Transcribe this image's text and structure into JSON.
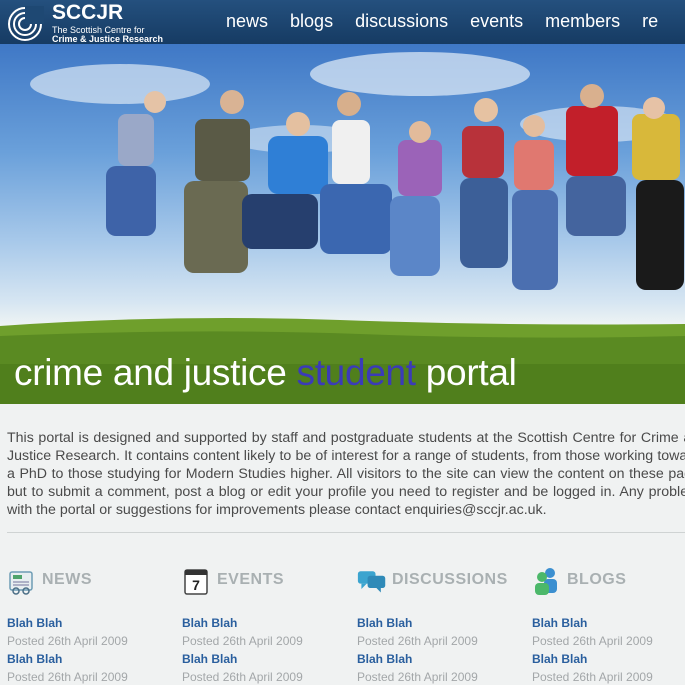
{
  "header": {
    "logo_title": "SCCJR",
    "logo_line1": "The Scottish Centre for",
    "logo_line2": "Crime & Justice Research",
    "nav": [
      "news",
      "blogs",
      "discussions",
      "events",
      "members",
      "re"
    ]
  },
  "hero": {
    "title_before": "crime and justice ",
    "title_accent": "student",
    "title_after": " portal",
    "accent_color": "#3b3bb8"
  },
  "intro": {
    "text": "This portal is designed and supported by staff and postgraduate students at the Scottish Centre for Crime and Justice Research. It contains content likely to be of interest for a range of students, from those working towards a PhD to those studying for Modern Studies higher. All visitors to the site can view the content on these pages but to submit a comment, post a blog or edit your profile you need to register and be logged in. Any problems with the portal or suggestions for improvements please contact enquiries@sccjr.ac.uk."
  },
  "columns": [
    {
      "label": "NEWS",
      "icon": "newspaper-icon",
      "items": [
        {
          "title": "Blah Blah",
          "date": "Posted 26th April 2009"
        },
        {
          "title": "Blah Blah",
          "date": "Posted 26th April 2009"
        }
      ]
    },
    {
      "label": "EVENTS",
      "icon": "calendar-icon",
      "items": [
        {
          "title": "Blah Blah",
          "date": "Posted 26th April 2009"
        },
        {
          "title": "Blah Blah",
          "date": "Posted 26th April 2009"
        }
      ]
    },
    {
      "label": "DISCUSSIONS",
      "icon": "speech-bubbles-icon",
      "items": [
        {
          "title": "Blah Blah",
          "date": "Posted 26th April 2009"
        },
        {
          "title": "Blah Blah",
          "date": "Posted 26th April 2009"
        }
      ]
    },
    {
      "label": "BLOGS",
      "icon": "people-icon",
      "items": [
        {
          "title": "Blah Blah",
          "date": "Posted 26th April 2009"
        },
        {
          "title": "Blah Blah",
          "date": "Posted 26th April 2009"
        }
      ]
    }
  ],
  "colors": {
    "header_bg": "#1e4873",
    "link": "#2a5f9e",
    "muted": "#a3a7a9"
  }
}
